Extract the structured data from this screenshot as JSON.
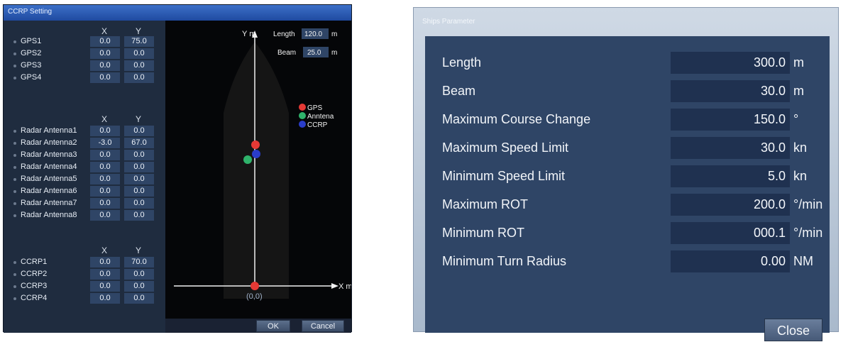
{
  "ccrp": {
    "title": "CCRP Setting",
    "col_x": "X",
    "col_y": "Y",
    "gps": [
      {
        "label": "GPS1",
        "x": "0.0",
        "y": "75.0"
      },
      {
        "label": "GPS2",
        "x": "0.0",
        "y": "0.0"
      },
      {
        "label": "GPS3",
        "x": "0.0",
        "y": "0.0"
      },
      {
        "label": "GPS4",
        "x": "0.0",
        "y": "0.0"
      }
    ],
    "radar": [
      {
        "label": "Radar Antenna1",
        "x": "0.0",
        "y": "0.0"
      },
      {
        "label": "Radar Antenna2",
        "x": "-3.0",
        "y": "67.0"
      },
      {
        "label": "Radar Antenna3",
        "x": "0.0",
        "y": "0.0"
      },
      {
        "label": "Radar Antenna4",
        "x": "0.0",
        "y": "0.0"
      },
      {
        "label": "Radar Antenna5",
        "x": "0.0",
        "y": "0.0"
      },
      {
        "label": "Radar Antenna6",
        "x": "0.0",
        "y": "0.0"
      },
      {
        "label": "Radar Antenna7",
        "x": "0.0",
        "y": "0.0"
      },
      {
        "label": "Radar Antenna8",
        "x": "0.0",
        "y": "0.0"
      }
    ],
    "ccrp_rows": [
      {
        "label": "CCRP1",
        "x": "0.0",
        "y": "70.0"
      },
      {
        "label": "CCRP2",
        "x": "0.0",
        "y": "0.0"
      },
      {
        "label": "CCRP3",
        "x": "0.0",
        "y": "0.0"
      },
      {
        "label": "CCRP4",
        "x": "0.0",
        "y": "0.0"
      }
    ],
    "diagram": {
      "y_axis_label": "Y m",
      "x_axis_label": "X m",
      "origin_label": "(0,0)",
      "length_label": "Length",
      "length_value": "120.0",
      "beam_label": "Beam",
      "beam_value": "25.0",
      "unit": "m",
      "legend": [
        {
          "label": "GPS",
          "color": "#e53935"
        },
        {
          "label": "Anntena",
          "color": "#2fb36b"
        },
        {
          "label": "CCRP",
          "color": "#2a3dc9"
        }
      ]
    },
    "ok_label": "OK",
    "cancel_label": "Cancel"
  },
  "ships": {
    "title": "Ships Parameter",
    "rows": [
      {
        "label": "Length",
        "value": "300.0",
        "unit": "m"
      },
      {
        "label": "Beam",
        "value": "30.0",
        "unit": "m"
      },
      {
        "label": "Maximum Course Change",
        "value": "150.0",
        "unit": "°"
      },
      {
        "label": "Maximum Speed Limit",
        "value": "30.0",
        "unit": "kn"
      },
      {
        "label": "Minimum Speed Limit",
        "value": "5.0",
        "unit": "kn"
      },
      {
        "label": "Maximum ROT",
        "value": "200.0",
        "unit": "°/min"
      },
      {
        "label": "Minimum ROT",
        "value": "000.1",
        "unit": "°/min"
      },
      {
        "label": "Minimum Turn Radius",
        "value": "0.00",
        "unit": "NM"
      }
    ],
    "close_label": "Close"
  }
}
